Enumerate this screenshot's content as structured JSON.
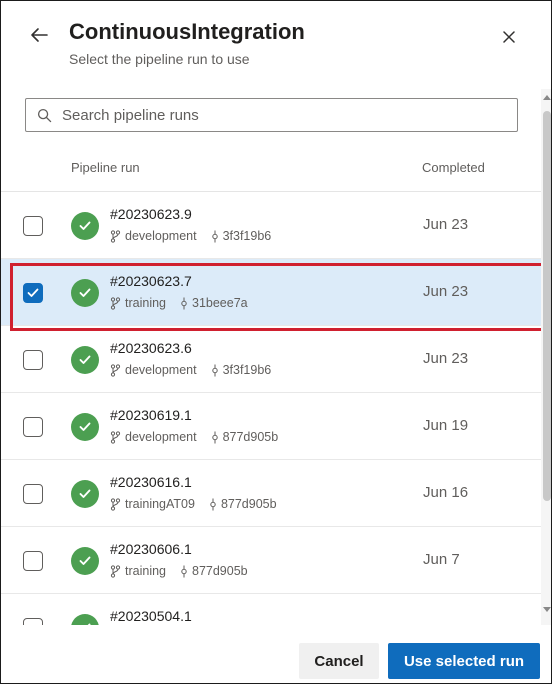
{
  "dialog": {
    "title": "ContinuousIntegration",
    "subtitle": "Select the pipeline run to use"
  },
  "search": {
    "placeholder": "Search pipeline runs",
    "value": ""
  },
  "table": {
    "columns": [
      "Pipeline run",
      "Completed"
    ],
    "rows": [
      {
        "run": "#20230623.9",
        "branch": "development",
        "commit": "3f3f19b6",
        "completed": "Jun 23",
        "selected": false,
        "status": "succeeded"
      },
      {
        "run": "#20230623.7",
        "branch": "training",
        "commit": "31beee7a",
        "completed": "Jun 23",
        "selected": true,
        "status": "succeeded"
      },
      {
        "run": "#20230623.6",
        "branch": "development",
        "commit": "3f3f19b6",
        "completed": "Jun 23",
        "selected": false,
        "status": "succeeded"
      },
      {
        "run": "#20230619.1",
        "branch": "development",
        "commit": "877d905b",
        "completed": "Jun 19",
        "selected": false,
        "status": "succeeded"
      },
      {
        "run": "#20230616.1",
        "branch": "trainingAT09",
        "commit": "877d905b",
        "completed": "Jun 16",
        "selected": false,
        "status": "succeeded"
      },
      {
        "run": "#20230606.1",
        "branch": "training",
        "commit": "877d905b",
        "completed": "Jun 7",
        "selected": false,
        "status": "succeeded"
      },
      {
        "run": "#20230504.1",
        "branch": "",
        "commit": "",
        "completed": "",
        "selected": false,
        "status": "succeeded"
      }
    ]
  },
  "footer": {
    "cancel_label": "Cancel",
    "confirm_label": "Use selected run"
  },
  "colors": {
    "accent": "#0f6cbd",
    "success": "#4c9f51",
    "selected_row": "#dcebf9",
    "highlight_border": "#d0202f"
  },
  "icons": [
    "back-arrow-icon",
    "close-icon",
    "search-icon",
    "checkmark-icon",
    "branch-icon",
    "commit-icon"
  ]
}
